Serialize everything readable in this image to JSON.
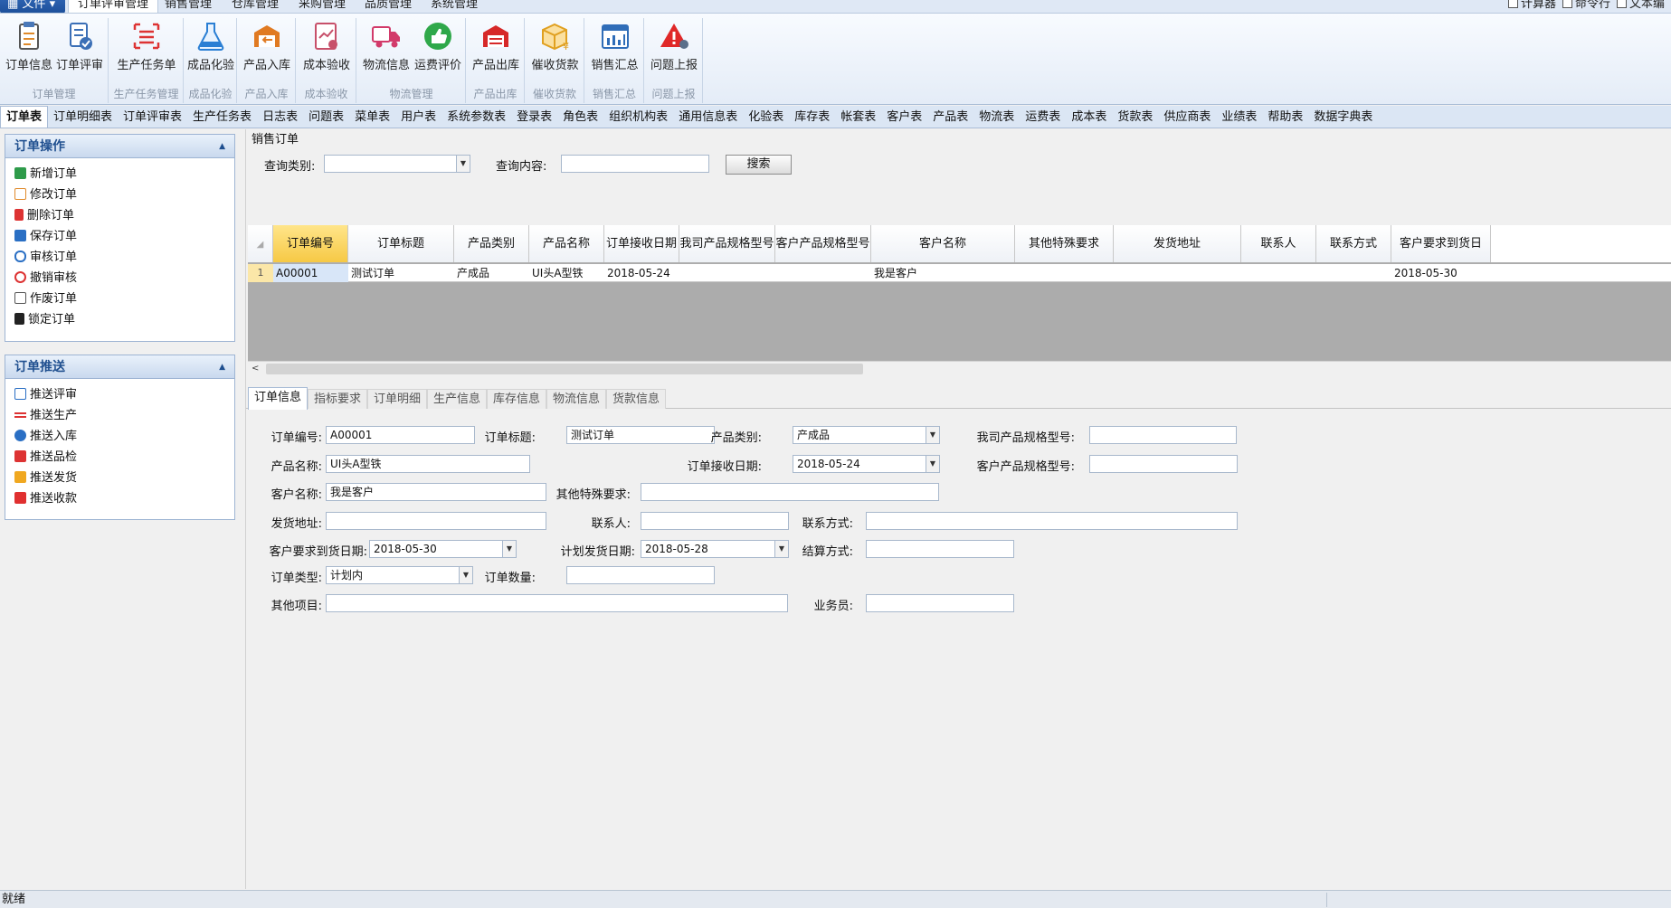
{
  "menubar": {
    "file_label": "文件",
    "tabs": [
      "订单评审管理",
      "销售管理",
      "仓库管理",
      "采购管理",
      "品质管理",
      "系统管理"
    ],
    "quick": [
      "计算器",
      "命令行",
      "文本编"
    ]
  },
  "ribbon": {
    "groups": [
      {
        "label": "订单管理",
        "buttons": [
          "订单信息",
          "订单评审"
        ]
      },
      {
        "label": "生产任务管理",
        "buttons": [
          "生产任务单"
        ]
      },
      {
        "label": "成品化验",
        "buttons": [
          "成品化验"
        ]
      },
      {
        "label": "产品入库",
        "buttons": [
          "产品入库"
        ]
      },
      {
        "label": "成本验收",
        "buttons": [
          "成本验收"
        ]
      },
      {
        "label": "物流管理",
        "buttons": [
          "物流信息",
          "运费评价"
        ]
      },
      {
        "label": "产品出库",
        "buttons": [
          "产品出库"
        ]
      },
      {
        "label": "催收货款",
        "buttons": [
          "催收货款"
        ]
      },
      {
        "label": "销售汇总",
        "buttons": [
          "销售汇总"
        ]
      },
      {
        "label": "问题上报",
        "buttons": [
          "问题上报"
        ]
      }
    ]
  },
  "table_tabs": [
    "订单表",
    "订单明细表",
    "订单评审表",
    "生产任务表",
    "日志表",
    "问题表",
    "菜单表",
    "用户表",
    "系统参数表",
    "登录表",
    "角色表",
    "组织机构表",
    "通用信息表",
    "化验表",
    "库存表",
    "帐套表",
    "客户表",
    "产品表",
    "物流表",
    "运费表",
    "成本表",
    "货款表",
    "供应商表",
    "业绩表",
    "帮助表",
    "数据字典表"
  ],
  "order_ops": {
    "title": "订单操作",
    "items": [
      "新增订单",
      "修改订单",
      "删除订单",
      "保存订单",
      "审核订单",
      "撤销审核",
      "作废订单",
      "锁定订单"
    ]
  },
  "order_push": {
    "title": "订单推送",
    "items": [
      "推送评审",
      "推送生产",
      "推送入库",
      "推送品检",
      "推送发货",
      "推送收款"
    ]
  },
  "query": {
    "title": "销售订单",
    "type_label": "查询类别:",
    "type_value": "",
    "content_label": "查询内容:",
    "content_value": "",
    "search_label": "搜索"
  },
  "grid": {
    "columns": [
      "订单编号",
      "订单标题",
      "产品类别",
      "产品名称",
      "订单接收日期",
      "我司产品规格型号",
      "客户产品规格型号",
      "客户名称",
      "其他特殊要求",
      "发货地址",
      "联系人",
      "联系方式",
      "客户要求到货日"
    ],
    "rows": [
      {
        "num": "1",
        "cells": [
          "A00001",
          "测试订单",
          "产成品",
          "UI头A型铁",
          "2018-05-24",
          "",
          "",
          "我是客户",
          "",
          "",
          "",
          "",
          "2018-05-30"
        ]
      }
    ]
  },
  "detail_tabs": [
    "订单信息",
    "指标要求",
    "订单明细",
    "生产信息",
    "库存信息",
    "物流信息",
    "货款信息"
  ],
  "form": {
    "order_no": {
      "label": "订单编号:",
      "value": "A00001"
    },
    "order_title": {
      "label": "订单标题:",
      "value": "测试订单"
    },
    "product_category": {
      "label": "产品类别:",
      "value": "产成品"
    },
    "our_spec": {
      "label": "我司产品规格型号:",
      "value": ""
    },
    "product_name": {
      "label": "产品名称:",
      "value": "UI头A型铁"
    },
    "receive_date": {
      "label": "订单接收日期:",
      "value": "2018-05-24"
    },
    "customer_spec": {
      "label": "客户产品规格型号:",
      "value": ""
    },
    "customer_name": {
      "label": "客户名称:",
      "value": "我是客户"
    },
    "special_req": {
      "label": "其他特殊要求:",
      "value": ""
    },
    "ship_address": {
      "label": "发货地址:",
      "value": ""
    },
    "contact": {
      "label": "联系人:",
      "value": ""
    },
    "contact_method": {
      "label": "联系方式:",
      "value": ""
    },
    "arrival_date": {
      "label": "客户要求到货日期:",
      "value": "2018-05-30"
    },
    "plan_ship_date": {
      "label": "计划发货日期:",
      "value": "2018-05-28"
    },
    "settlement": {
      "label": "结算方式:",
      "value": ""
    },
    "order_type": {
      "label": "订单类型:",
      "value": "计划内"
    },
    "order_qty": {
      "label": "订单数量:",
      "value": ""
    },
    "other_items": {
      "label": "其他项目:",
      "value": ""
    },
    "salesman": {
      "label": "业务员:",
      "value": ""
    }
  },
  "status": {
    "text": "就绪"
  },
  "colors": {
    "accent": "#1d4f9a",
    "selected_header": "#f6c843",
    "grid_bg": "#acacac"
  }
}
